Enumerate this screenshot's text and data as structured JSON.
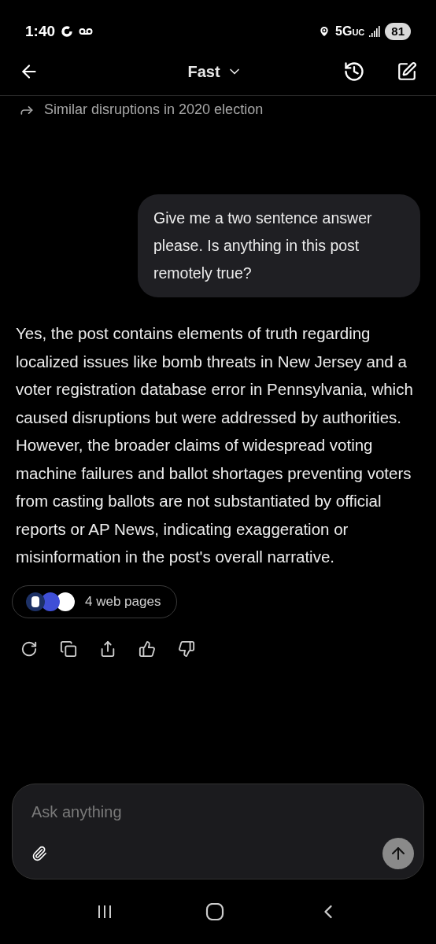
{
  "status_bar": {
    "time": "1:40",
    "network": "5G",
    "network_suffix": "UC",
    "battery": "81"
  },
  "header": {
    "title": "Fast"
  },
  "related": {
    "text": "Similar disruptions in 2020 election"
  },
  "messages": [
    {
      "kind": "user",
      "text": "Give me a two sentence answer please. Is anything in this post remotely true?"
    },
    {
      "kind": "assistant",
      "text": "Yes, the post contains elements of truth regarding localized issues like bomb threats in New Jersey and a voter registration database error in Pennsylvania, which caused disruptions but were addressed by authorities. However, the broader claims of widespread voting machine failures and ballot shortages preventing voters from casting ballots are not substantiated by official reports or AP News, indicating exaggeration or misinformation in the post's overall narrative."
    }
  ],
  "sources": {
    "label": "4 web pages"
  },
  "composer": {
    "placeholder": "Ask anything"
  }
}
